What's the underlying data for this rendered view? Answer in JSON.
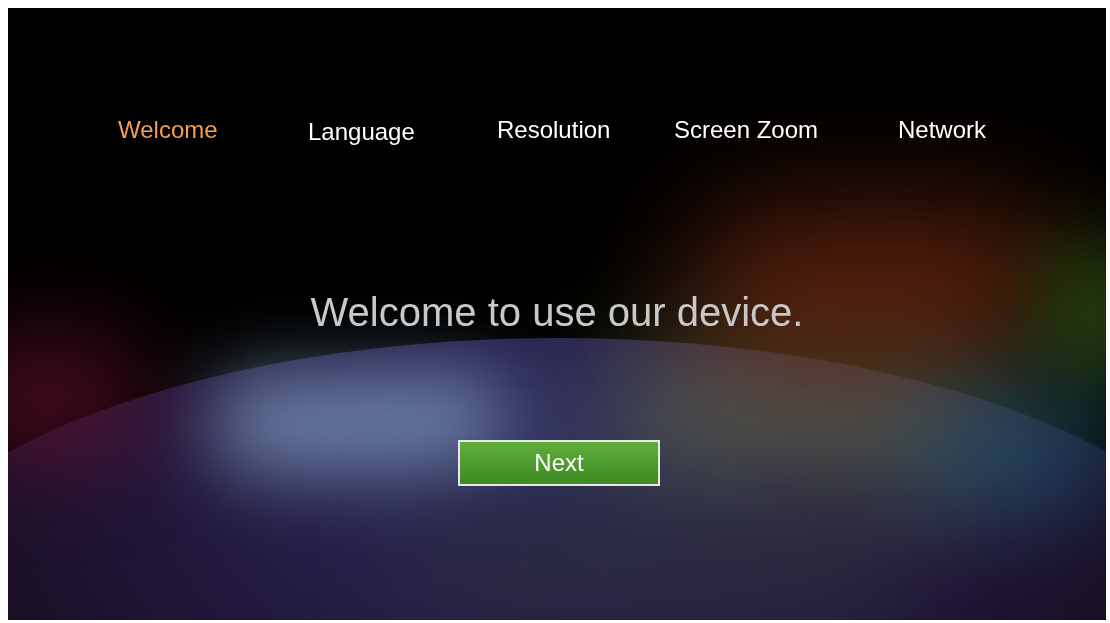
{
  "tabs": [
    {
      "label": "Welcome",
      "selected": true
    },
    {
      "label": "Language",
      "selected": false
    },
    {
      "label": "Resolution",
      "selected": false
    },
    {
      "label": "Screen Zoom",
      "selected": false
    },
    {
      "label": "Network",
      "selected": false
    }
  ],
  "message": "Welcome to use our device.",
  "next_button": "Next"
}
